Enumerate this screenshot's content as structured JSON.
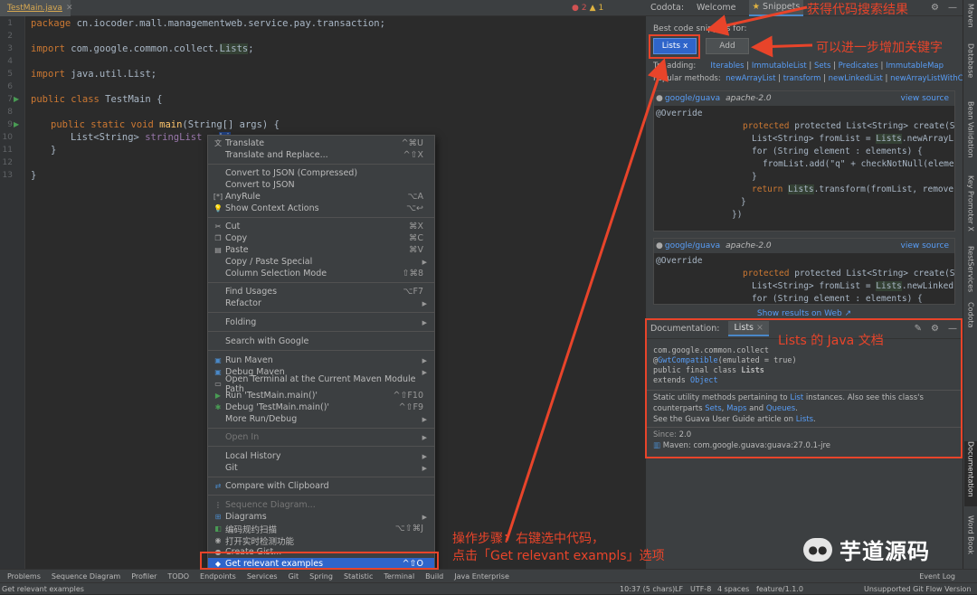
{
  "editor": {
    "tab_name": "TestMain.java",
    "inspections": {
      "errors": "2",
      "warnings": "1"
    },
    "line_numbers": [
      "1",
      "2",
      "3",
      "4",
      "5",
      "6",
      "7",
      "8",
      "9",
      "10",
      "11",
      "12",
      "13"
    ],
    "lines": {
      "l1": {
        "kw": "package",
        "rest": " cn.iocoder.mall.managementweb.service.pay.transaction;"
      },
      "l3": {
        "kw": "import",
        "rest": " com.google.common.collect.",
        "hl": "Lists",
        "end": ";"
      },
      "l5": {
        "kw": "import",
        "rest": " java.util.List;"
      },
      "l7": {
        "kw": "public class",
        "rest": " TestMain {"
      },
      "l9": {
        "kw": "public static void",
        "fn": "main",
        "rest": "(String[] args) {"
      },
      "l10": {
        "pre": "List<String> ",
        "var": "stringList",
        "mid": " = ",
        "sel": "Li"
      },
      "l11": "}",
      "l13": "}"
    }
  },
  "context_menu": {
    "translate": "Translate",
    "translate_sc": "^⌘U",
    "translate_replace": "Translate and Replace...",
    "translate_replace_sc": "^⇧X",
    "convert_json_compressed": "Convert to JSON (Compressed)",
    "convert_json": "Convert to JSON",
    "anyrule": "AnyRule",
    "anyrule_sc": "⌥A",
    "show_context_actions": "Show Context Actions",
    "show_context_actions_sc": "⌥↩",
    "cut": "Cut",
    "cut_sc": "⌘X",
    "copy": "Copy",
    "copy_sc": "⌘C",
    "paste": "Paste",
    "paste_sc": "⌘V",
    "copy_paste_special": "Copy / Paste Special",
    "column_selection": "Column Selection Mode",
    "column_selection_sc": "⇧⌘8",
    "find_usages": "Find Usages",
    "find_usages_sc": "⌥F7",
    "refactor": "Refactor",
    "folding": "Folding",
    "search_google": "Search with Google",
    "run_maven": "Run Maven",
    "debug_maven": "Debug Maven",
    "open_terminal": "Open Terminal at the Current Maven Module Path",
    "run_main": "Run 'TestMain.main()'",
    "run_main_sc": "^⇧F10",
    "debug_main": "Debug 'TestMain.main()'",
    "debug_main_sc": "^⇧F9",
    "more_run_debug": "More Run/Debug",
    "open_in": "Open In",
    "local_history": "Local History",
    "git": "Git",
    "compare_clipboard": "Compare with Clipboard",
    "sequence_diagram": "Sequence Diagram...",
    "diagrams": "Diagrams",
    "code_scan": "编码规约扫描",
    "code_scan_sc": "⌥⇧⌘J",
    "realtime_detect": "打开实时检测功能",
    "create_gist": "Create Gist...",
    "get_examples": "Get relevant examples",
    "get_examples_sc": "^⇧O"
  },
  "codota": {
    "title": "Codota:",
    "tab_welcome": "Welcome",
    "tab_snippets": "Snippets",
    "best_label": "Best code snippets for:",
    "chip": "Lists",
    "chip_close": "x",
    "add_button": "Add",
    "try_label": "Try adding:",
    "try_items": [
      "Iterables",
      "ImmutableList",
      "Sets",
      "Predicates",
      "ImmutableMap"
    ],
    "popular_label": "Popular methods:",
    "popular_items": [
      "newArrayList",
      "transform",
      "newLinkedList",
      "newArrayListWithC"
    ],
    "snippet1": {
      "source": "google/guava",
      "license": "apache-2.0",
      "view": "view source",
      "l1": "@Override",
      "l2": "protected List<String> create(String[] eleme",
      "l3a": "List<String> fromList = ",
      "l3hl": "Lists",
      "l3b": ".newArrayList",
      "l4": "for (String element : elements) {",
      "l5": "fromList.add(\"q\" + checkNotNull(element)",
      "l6": "}",
      "l7a": "return ",
      "l7hl": "Lists",
      "l7b": ".transform(fromList, removeFir",
      "l8": "}",
      "l9": "})"
    },
    "snippet2": {
      "source": "google/guava",
      "license": "apache-2.0",
      "view": "view source",
      "l1": "@Override",
      "l2": "protected List<String> create(String[] eleme",
      "l3a": "List<String> fromList = ",
      "l3hl": "Lists",
      "l3b": ".newLinkedLis",
      "l4": "for (String element : elements) {"
    },
    "show_results": "Show results on Web ↗"
  },
  "documentation": {
    "title": "Documentation:",
    "tab": "Lists",
    "tab_close": "×",
    "pkg": "com.google.common.collect",
    "gwt_a": "@",
    "gwt_link": "GwtCompatible",
    "gwt_b": "(emulated = true)",
    "decl_a": "public final class ",
    "decl_b": "Lists",
    "extends_a": "extends ",
    "extends_b": "Object",
    "desc1_a": "Static utility methods pertaining to ",
    "desc1_link": "List",
    "desc1_b": " instances. Also see this class's",
    "desc2_a": "counterparts ",
    "desc2_l1": "Sets",
    "desc2_c": ", ",
    "desc2_l2": "Maps",
    "desc2_d": " and ",
    "desc2_l3": "Queues",
    "desc2_e": ".",
    "desc3_a": "See the Guava User Guide article on ",
    "desc3_link": "Lists",
    "desc3_b": ".",
    "since_label": "Since:",
    "since_value": "2.0",
    "maven": "Maven: com.google.guava:guava:27.0.1-jre"
  },
  "right_toolbar": [
    "Maven",
    "Database",
    "Bean Validation",
    "Key Promoter X",
    "RestServices",
    "Codota",
    "Documentation",
    "Word Book"
  ],
  "status_bar": {
    "tools": [
      "Problems",
      "Sequence Diagram",
      "Profiler",
      "TODO",
      "Endpoints",
      "Services",
      "Git",
      "Spring",
      "Statistic",
      "Terminal",
      "Build",
      "Java Enterprise"
    ],
    "event_log": "Event Log",
    "message": "Get relevant examples",
    "position": "10:37 (5 chars)",
    "line_sep": "LF",
    "encoding": "UTF-8",
    "indent": "4 spaces",
    "branch": "feature/1.1.0",
    "git_flow": "Unsupported Git Flow Version"
  },
  "annotations": {
    "search_results": "获得代码搜索结果",
    "add_keyword": "可以进一步增加关键字",
    "lists_doc": "Lists 的 Java 文档",
    "steps_1": "操作步骤：右键选中代码，",
    "steps_2": "点击「Get relevant exampls」选项",
    "color": "#e8442a"
  },
  "watermark": "芋道源码"
}
